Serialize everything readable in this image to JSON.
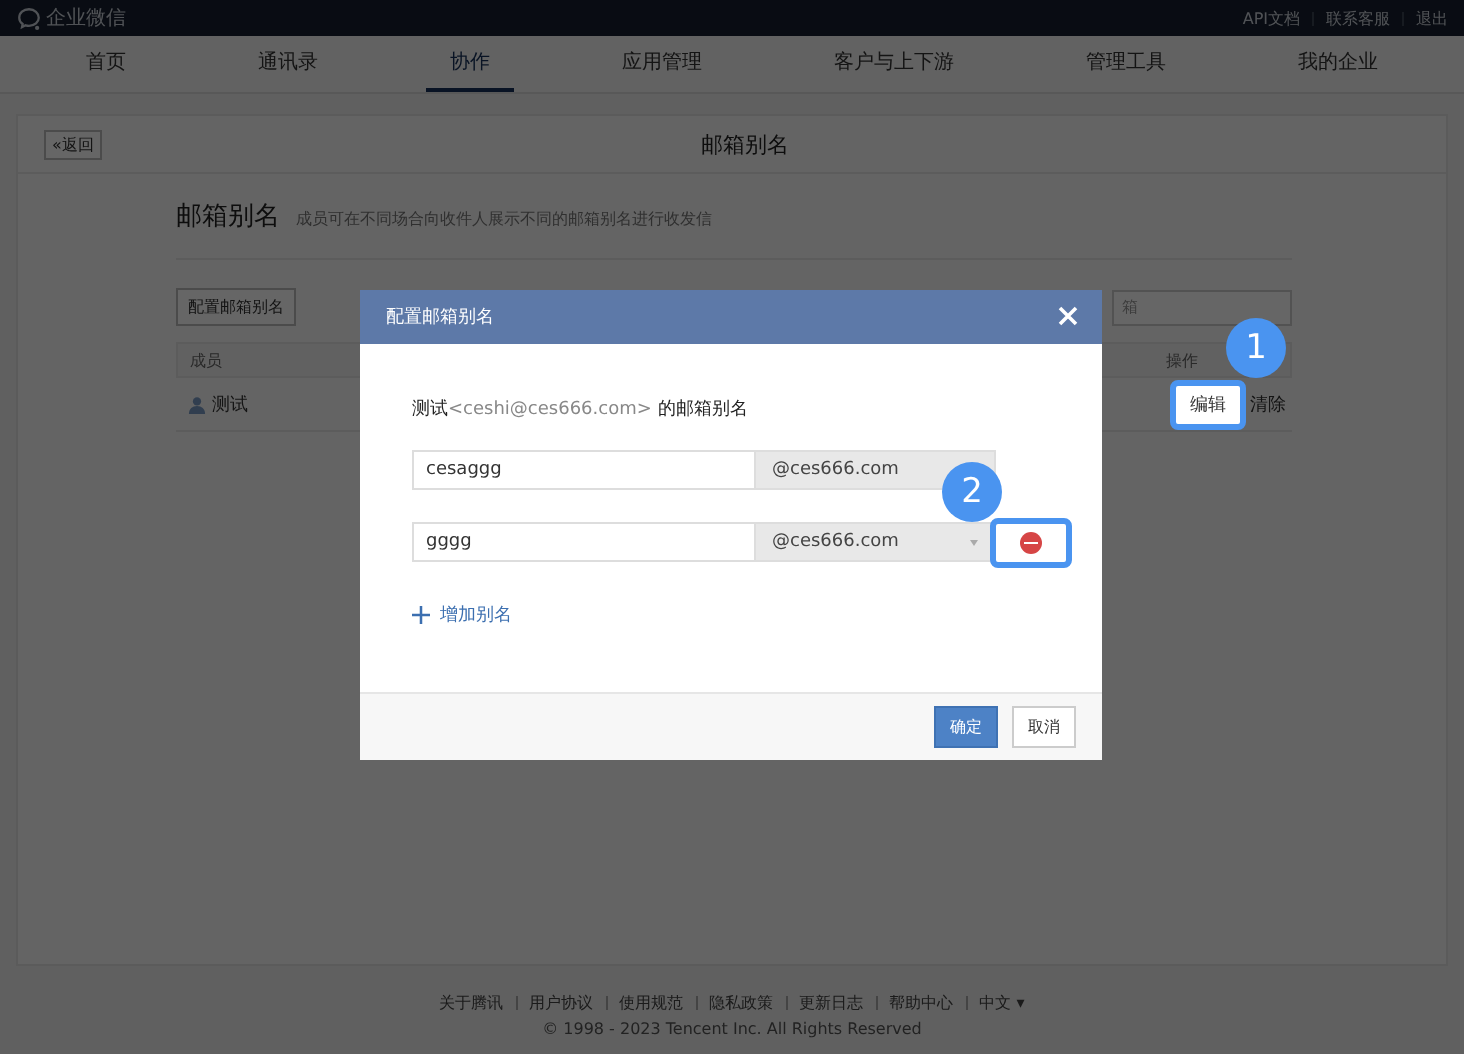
{
  "topbar": {
    "logo": "企业微信",
    "links": [
      "API文档",
      "联系客服",
      "退出"
    ]
  },
  "nav": [
    {
      "label": "首页",
      "selected": false
    },
    {
      "label": "通讯录",
      "selected": false
    },
    {
      "label": "协作",
      "selected": true
    },
    {
      "label": "应用管理",
      "selected": false
    },
    {
      "label": "客户与上下游",
      "selected": false
    },
    {
      "label": "管理工具",
      "selected": false
    },
    {
      "label": "我的企业",
      "selected": false
    }
  ],
  "page": {
    "back": "«返回",
    "title": "邮箱别名",
    "heading": "邮箱别名",
    "description": "成员可在不同场合向收件人展示不同的邮箱别名进行收发信",
    "configure_button": "配置邮箱别名",
    "search": {
      "placeholder": "箱"
    },
    "table": {
      "columns": [
        "成员",
        "操作"
      ],
      "rows": [
        {
          "member": "测试",
          "actions": [
            "编辑",
            "清除"
          ]
        }
      ]
    }
  },
  "dialog": {
    "title": "配置邮箱别名",
    "subject": {
      "name": "测试",
      "email": "<ceshi@ces666.com>",
      "suffix": " 的邮箱别名"
    },
    "aliases": [
      {
        "value": "cesaggg",
        "domain": "@ces666.com",
        "kind": "fixed"
      },
      {
        "value": "gggg",
        "domain": "@ces666.com",
        "kind": "select"
      }
    ],
    "add": "增加别名",
    "buttons": [
      {
        "label": "确定",
        "kind": "primary"
      },
      {
        "label": "取消",
        "kind": "default"
      }
    ]
  },
  "annotations": [
    {
      "label": "1"
    },
    {
      "label": "2"
    }
  ],
  "footer": {
    "links": [
      "关于腾讯",
      "用户协议",
      "使用规范",
      "隐私政策",
      "更新日志",
      "帮助中心",
      "中文 ▾"
    ],
    "copyright": "© 1998 - 2023 Tencent Inc. All Rights Reserved"
  }
}
